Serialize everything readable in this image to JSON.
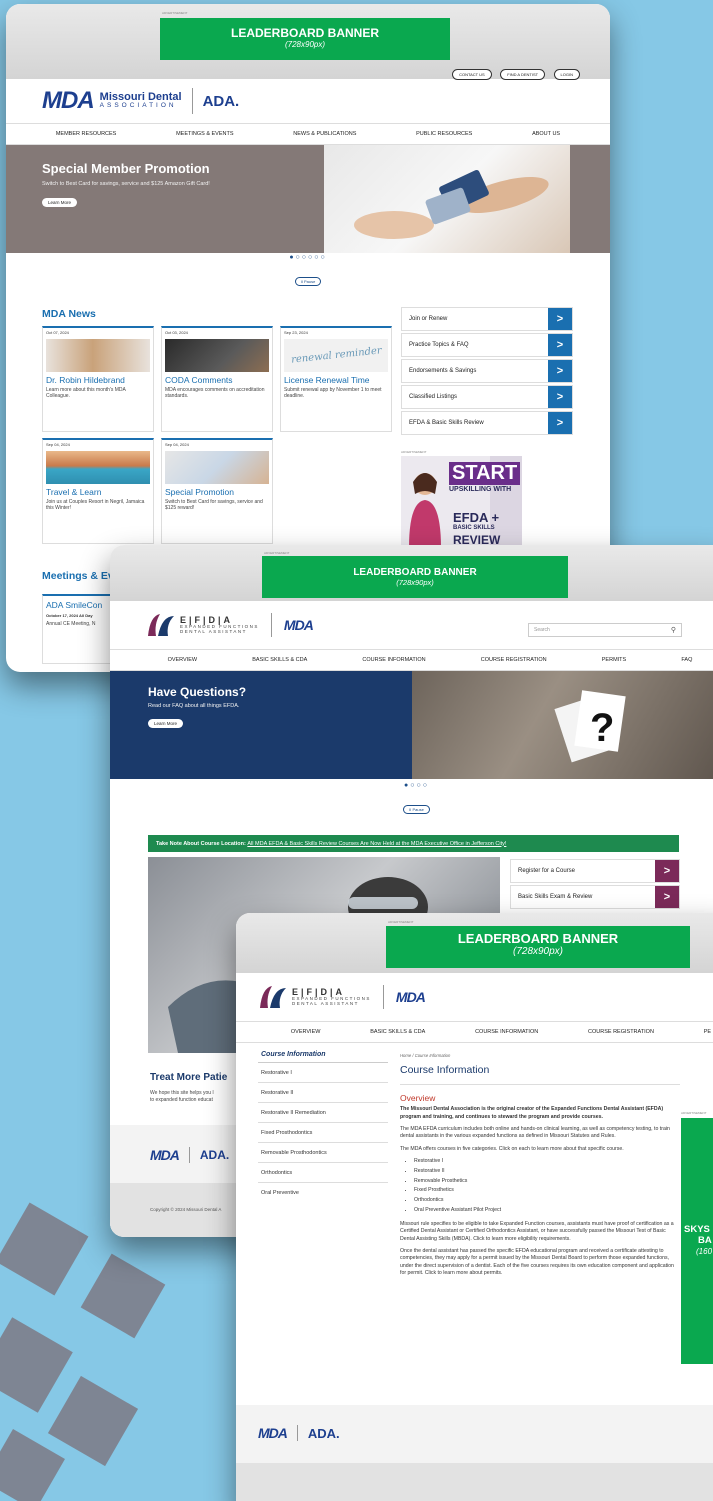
{
  "common": {
    "ad_label": "ADVERTISEMENT",
    "leaderboard_title": "LEADERBOARD BANNER",
    "leaderboard_sub": "(728x90px)",
    "mda_logo": "MDA",
    "ada_logo": "ADA.",
    "pause_label": "II Pause",
    "learn_more": "Learn More",
    "chevron": ">"
  },
  "w1": {
    "top_buttons": [
      "CONTACT US",
      "FIND A DENTIST",
      "LOGIN"
    ],
    "org_name_line1": "Missouri Dental",
    "org_name_line2": "ASSOCIATION",
    "nav": [
      "MEMBER RESOURCES",
      "MEETINGS & EVENTS",
      "NEWS & PUBLICATIONS",
      "PUBLIC RESOURCES",
      "ABOUT US"
    ],
    "hero_title": "Special Member Promotion",
    "hero_text": "Switch to Best Card for savings, service and $125 Amazon Gift Card!",
    "dots": "●○○○○○",
    "news_title": "MDA News",
    "news": [
      {
        "date": "Oct 07, 2024",
        "title": "Dr. Robin Hildebrand",
        "desc": "Learn more about this month's MDA Colleague."
      },
      {
        "date": "Oct 03, 2024",
        "title": "CODA Comments",
        "desc": "MDA encourages comments on accreditation standards."
      },
      {
        "date": "Sep 23, 2024",
        "title": "License Renewal Time",
        "desc": "Submit renewal app by November 1 to meet deadline."
      },
      {
        "date": "Sep 04, 2024",
        "title": "Travel & Learn",
        "desc": "Join us at Couples Resort in Negril, Jamaica this Winter!"
      },
      {
        "date": "Sep 04, 2024",
        "title": "Special Promotion",
        "desc": "Switch to Best Card for savings, service and $125 reward!"
      }
    ],
    "renewal_img_text": "renewal reminder",
    "quick_links": [
      "Join or Renew",
      "Practice Topics & FAQ",
      "Endorsements & Savings",
      "Classified Listings",
      "EFDA & Basic Skills Review"
    ],
    "ad_start": "START",
    "ad_upskilling": "UPSKILLING WITH",
    "ad_efda": "EFDA +",
    "ad_basic": "BASIC SKILLS",
    "ad_review": "REVIEW",
    "meetings_title": "Meetings & Ev",
    "meeting_title": "ADA SmileCon",
    "meeting_date": "October 17, 2024 All Day",
    "meeting_desc": "Annual CE Meeting, N"
  },
  "w2": {
    "efda_letters": "E|F|D|A",
    "efda_line1": "EXPANDED FUNCTIONS",
    "efda_line2": "DENTAL ASSISTANT",
    "search_placeholder": "Search",
    "search_icon": "⚲",
    "nav": [
      "OVERVIEW",
      "BASIC SKILLS & CDA",
      "COURSE INFORMATION",
      "COURSE REGISTRATION",
      "PERMITS",
      "FAQ"
    ],
    "hero_title": "Have Questions?",
    "hero_text": "Read our FAQ about all things EFDA.",
    "dots": "●○○○",
    "notice_bold": "Take Note About Course Location:",
    "notice_link": "All MDA EFDA & Basic Skills Review Courses Are Now Held at the MDA Executive Office in Jefferson City!",
    "quick_links": [
      "Register for a Course",
      "Basic Skills Exam & Review"
    ],
    "treat_title": "Treat More Patie",
    "treat_line1": "We hope this site helps you l",
    "treat_line2": "to expanded function educat",
    "copyright": "Copyright © 2024 Missouri Dental A"
  },
  "w3": {
    "nav": [
      "OVERVIEW",
      "BASIC SKILLS & CDA",
      "COURSE INFORMATION",
      "COURSE REGISTRATION",
      "PE"
    ],
    "sidebar_title": "Course Information",
    "sidebar": [
      "Restorative I",
      "Restorative II",
      "Restorative II Remediation",
      "Fixed Prosthodontics",
      "Removable Prosthodontics",
      "Orthodontics",
      "Oral Preventive"
    ],
    "crumb_home": "Home",
    "crumb_sep": "/",
    "crumb_current": "Course Information",
    "page_title": "Course Information",
    "overview": "Overview",
    "intro_bold": "The Missouri Dental Association is the original creator of the Expanded Functions Dental Assistant (EFDA) program and training, and continues to steward the program and provide courses.",
    "para1": "The MDA EFDA curriculum includes both online and hands-on clinical learning, as well as competency testing, to train dental assistants in the various expanded functions as defined in Missouri Statutes and Rules.",
    "para2": "The MDA offers courses in five categories. Click on each to learn more about that specific course.",
    "courses": [
      "Restorative I",
      "Restorative II",
      "Removable Prosthetics",
      "Fixed Prosthetics",
      "Orthodontics",
      "Oral Preventive Assistant Pilot Project"
    ],
    "para3": "Missouri rule specifies to be eligible to take Expanded Function courses, assistants must have proof of certification as a Certified Dental Assistant or Certified Orthodontics Assistant, or have successfully passed the Missouri Test of Basic Dental Assisting Skills (MBDA).",
    "para3_link": "Click to learn more eligibility requirements.",
    "para4": "Once the dental assistant has passed the specific EFDA educational program and received a certificate attesting to competencies, they may apply for a permit issued by the Missouri Dental Board to perform those expanded functions, under the direct supervision of a dentist. Each of the five courses requires its own education component and application for permit.",
    "para4_link": "Click to learn more about permits.",
    "sky1": "SKYS",
    "sky2": "BA",
    "sky3": "(160"
  },
  "colors": {
    "bg": "#86c8e6",
    "banner_green": "#0aa84f",
    "mda_blue": "#1a6fb0",
    "efda_purple": "#7b2a59",
    "efda_navy": "#1b3a6b"
  }
}
